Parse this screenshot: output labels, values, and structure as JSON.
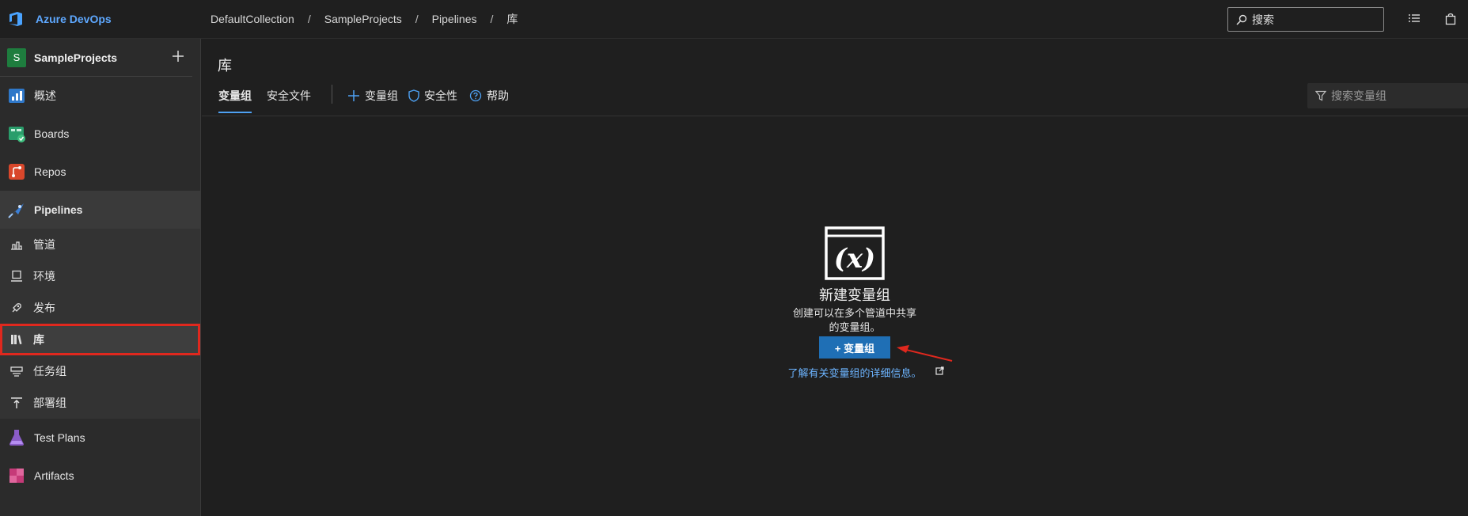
{
  "brand": {
    "name": "Azure DevOps",
    "logo_icon": "azure-devops-icon"
  },
  "breadcrumb": [
    "DefaultCollection",
    "SampleProjects",
    "Pipelines",
    "库"
  ],
  "breadcrumb_sep": "/",
  "top_search": {
    "placeholder": "搜索"
  },
  "project": {
    "badge": "S",
    "name": "SampleProjects",
    "badge_color": "#1e7d3e"
  },
  "sidebar": {
    "items": [
      {
        "label": "概述",
        "icon": "overview-icon"
      },
      {
        "label": "Boards",
        "icon": "boards-icon"
      },
      {
        "label": "Repos",
        "icon": "repos-icon"
      },
      {
        "label": "Pipelines",
        "icon": "pipelines-icon"
      }
    ],
    "pipelines_sub": [
      {
        "label": "管道",
        "icon": "pipeline-icon"
      },
      {
        "label": "环境",
        "icon": "environment-icon"
      },
      {
        "label": "发布",
        "icon": "rocket-icon"
      },
      {
        "label": "库",
        "icon": "library-icon",
        "selected": true
      },
      {
        "label": "任务组",
        "icon": "task-group-icon"
      },
      {
        "label": "部署组",
        "icon": "deployment-group-icon"
      }
    ],
    "bottom_items": [
      {
        "label": "Test Plans",
        "icon": "test-plans-icon"
      },
      {
        "label": "Artifacts",
        "icon": "artifacts-icon"
      }
    ]
  },
  "main": {
    "title": "库",
    "tabs": [
      {
        "label": "变量组",
        "active": true
      },
      {
        "label": "安全文件",
        "active": false
      }
    ],
    "toolbar": {
      "add_variable_group": "变量组",
      "security": "安全性",
      "help": "帮助"
    },
    "filter": {
      "placeholder": "搜索变量组"
    }
  },
  "empty_state": {
    "title": "新建变量组",
    "desc_line1": "创建可以在多个管道中共享",
    "desc_line2": "的变量组。",
    "button_label": "+ 变量组",
    "learn_more": "了解有关变量组的详细信息。"
  },
  "colors": {
    "accent": "#1f6fb5",
    "link": "#6cb4ff",
    "highlight_box": "#e0281e"
  }
}
